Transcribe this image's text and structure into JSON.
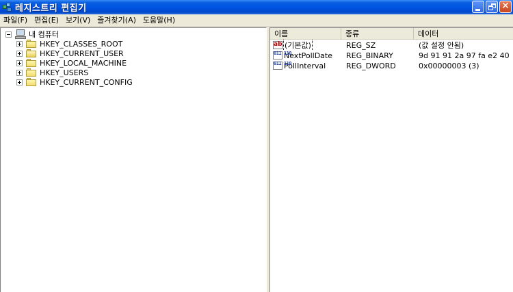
{
  "window": {
    "title": "레지스트리 편집기",
    "buttons": {
      "minimize": "minimize",
      "maximize": "maximize",
      "close": "✕"
    }
  },
  "menu": [
    {
      "label": "파일(F)"
    },
    {
      "label": "편집(E)"
    },
    {
      "label": "보기(V)"
    },
    {
      "label": "즐겨찾기(A)"
    },
    {
      "label": "도움말(H)"
    }
  ],
  "tree": {
    "root": {
      "label": "내 컴퓨터",
      "icon": "computer-icon",
      "expanded": true
    },
    "children": [
      {
        "label": "HKEY_CLASSES_ROOT",
        "icon": "folder-icon",
        "expanded": false
      },
      {
        "label": "HKEY_CURRENT_USER",
        "icon": "open-folder-icon",
        "expanded": false
      },
      {
        "label": "HKEY_LOCAL_MACHINE",
        "icon": "folder-icon",
        "expanded": false
      },
      {
        "label": "HKEY_USERS",
        "icon": "folder-icon",
        "expanded": false
      },
      {
        "label": "HKEY_CURRENT_CONFIG",
        "icon": "folder-icon",
        "expanded": false
      }
    ]
  },
  "list": {
    "columns": {
      "name": "이름",
      "type": "종류",
      "data": "데이터"
    },
    "rows": [
      {
        "name": "(기본값)",
        "type": "REG_SZ",
        "data": "(값 설정 안됨)",
        "icon": "string-value-icon",
        "icon_text": "ab"
      },
      {
        "name": "NextPollDate",
        "type": "REG_BINARY",
        "data": "9d 91 91 2a 97 fa e2 40",
        "icon": "binary-value-icon",
        "icon_text": "011 110"
      },
      {
        "name": "PollInterval",
        "type": "REG_DWORD",
        "data": "0x00000003 (3)",
        "icon": "binary-value-icon",
        "icon_text": "011 110"
      }
    ]
  },
  "colors": {
    "titlebar": "#0054e3",
    "close_button": "#c8461e",
    "chrome": "#ece9d8"
  }
}
